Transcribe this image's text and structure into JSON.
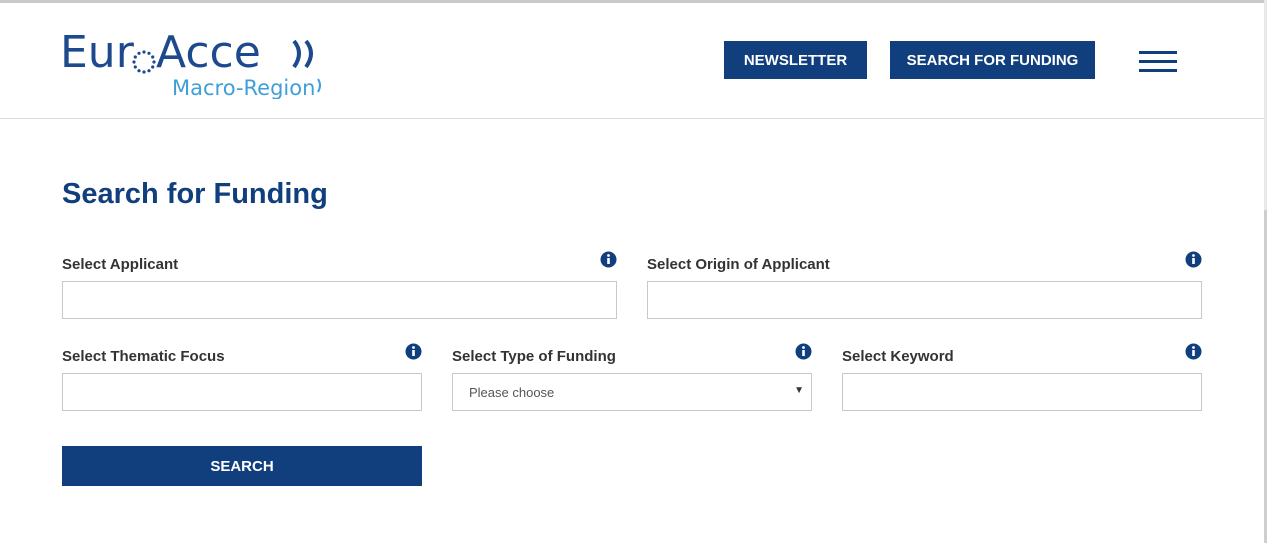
{
  "logo": {
    "primary": "EuroAccess",
    "secondary": "Macro-Regions",
    "colors": {
      "navy": "#1d4a8c",
      "light": "#3f9fd8"
    }
  },
  "header": {
    "newsletter_label": "NEWSLETTER",
    "search_funding_label": "SEARCH FOR FUNDING",
    "menu_icon": "hamburger-icon"
  },
  "main": {
    "title": "Search for Funding",
    "fields": {
      "applicant": {
        "label": "Select Applicant",
        "value": "",
        "icon": "info-icon"
      },
      "origin": {
        "label": "Select Origin of Applicant",
        "value": "",
        "icon": "info-icon"
      },
      "thematic": {
        "label": "Select Thematic Focus",
        "value": "",
        "icon": "info-icon"
      },
      "type": {
        "label": "Select Type of Funding",
        "selected": "Please choose",
        "icon": "info-icon"
      },
      "keyword": {
        "label": "Select Keyword",
        "value": "",
        "icon": "info-icon"
      }
    },
    "search_label": "SEARCH"
  },
  "colors": {
    "brand": "#113f7d",
    "border": "#c8c8c8"
  }
}
